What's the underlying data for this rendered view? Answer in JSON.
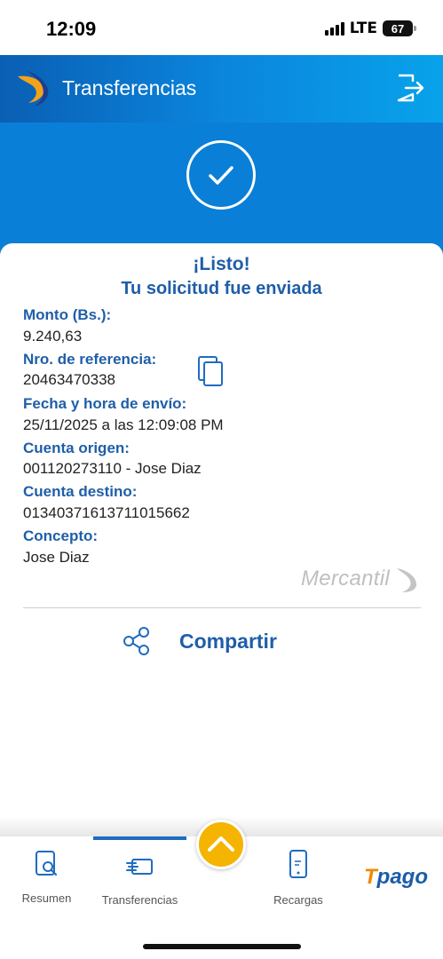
{
  "status_bar": {
    "time": "12:09",
    "network": "LTE",
    "battery": "67"
  },
  "header": {
    "title": "Transferencias"
  },
  "confirmation": {
    "title": "¡Listo!",
    "subtitle": "Tu solicitud fue enviada"
  },
  "details": [
    {
      "label": "Monto (Bs.):",
      "value": "9.240,63"
    },
    {
      "label": "Nro. de referencia:",
      "value": "20463470338"
    },
    {
      "label": "Fecha y hora de envío:",
      "value": "25/11/2025 a las 12:09:08 PM"
    },
    {
      "label": "Cuenta origen:",
      "value": "001120273110 - Jose Diaz"
    },
    {
      "label": "Cuenta destino:",
      "value": "01340371613711015662"
    },
    {
      "label": "Concepto:",
      "value": "Jose Diaz"
    }
  ],
  "brand": {
    "watermark": "Mercantil"
  },
  "actions": {
    "share_label": "Compartir"
  },
  "bottom_nav": {
    "items": [
      {
        "label": "Resumen",
        "icon": "search-document-icon"
      },
      {
        "label": "Transferencias",
        "icon": "transfer-icon",
        "active": true
      },
      {
        "label": "",
        "icon": "chevron-up-icon"
      },
      {
        "label": "Recargas",
        "icon": "phone-icon"
      }
    ],
    "tpago_t": "T",
    "tpago_rest": "pago"
  },
  "colors": {
    "primary_blue": "#1f5ea8",
    "header_gradient_start": "#0a5fb3",
    "header_gradient_end": "#08a2ea",
    "accent_yellow": "#f4b400",
    "tpago_orange": "#f08a00"
  }
}
